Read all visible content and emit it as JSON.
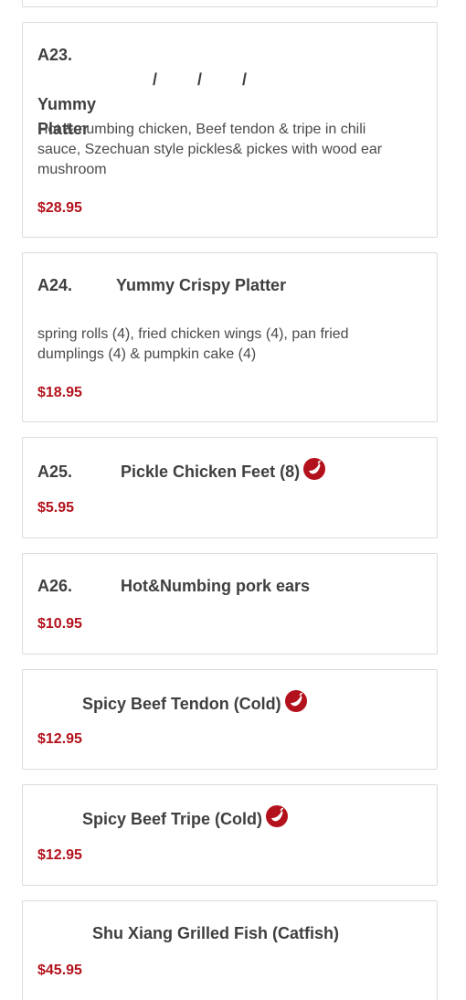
{
  "menu": {
    "items": [
      {
        "code": "A23.",
        "name": "/ / / Yummy Platter",
        "description": "Hot & numbing chicken, Beef tendon & tripe in chili sauce, Szechuan style pickles& pickes with wood ear mushroom",
        "price": "$28.95"
      },
      {
        "code": "A24.",
        "name": "Yummy Crispy Platter",
        "description": "spring rolls (4), fried chicken wings (4), pan fried dumplings (4) & pumpkin cake (4)",
        "price": "$18.95"
      },
      {
        "code": "A25.",
        "name": "Pickle Chicken Feet (8)",
        "price": "$5.95",
        "icon": "chili-pepper-icon"
      },
      {
        "code": "A26.",
        "name": "Hot&Numbing pork ears",
        "price": "$10.95"
      },
      {
        "name": "Spicy Beef Tendon (Cold)",
        "price": "$12.95",
        "icon": "chili-pepper-icon"
      },
      {
        "name": "Spicy Beef Tripe (Cold)",
        "price": "$12.95",
        "icon": "chili-pepper-icon"
      },
      {
        "name": "Shu Xiang Grilled Fish (Catfish)",
        "price": "$45.95"
      }
    ]
  },
  "colors": {
    "price": "#b3121c",
    "spicy_icon": "#b3121c",
    "card_border": "#dcdcdc"
  }
}
